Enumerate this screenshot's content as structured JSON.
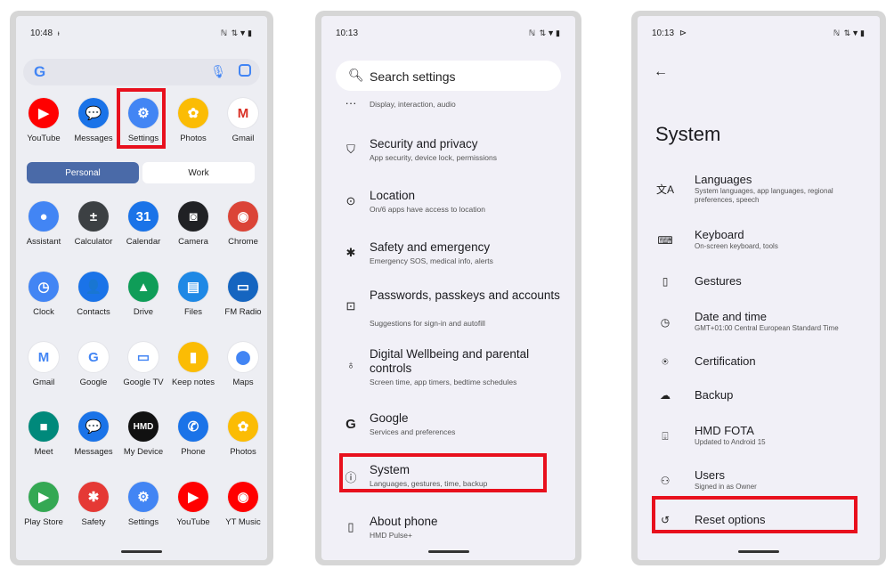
{
  "phone1": {
    "status_time": "10:48",
    "status_time_suffix": "ᵻ",
    "status_icons": "ℕ ⇅▼▮",
    "search_logo": "G",
    "top_apps": [
      {
        "label": "YouTube",
        "color": "#ff0000",
        "glyph": "▶"
      },
      {
        "label": "Messages",
        "color": "#1a73e8",
        "glyph": "💬"
      },
      {
        "label": "Settings",
        "color": "#4285f4",
        "glyph": "⚙"
      },
      {
        "label": "Photos",
        "color": "#fbbc04",
        "glyph": "✿"
      },
      {
        "label": "Gmail",
        "color": "#ffffff",
        "glyph": "M"
      }
    ],
    "tabs": {
      "personal": "Personal",
      "work": "Work"
    },
    "grid_apps": [
      {
        "label": "Assistant",
        "color": "#4285f4",
        "glyph": "●"
      },
      {
        "label": "Calculator",
        "color": "#3c4043",
        "glyph": "±"
      },
      {
        "label": "Calendar",
        "color": "#1a73e8",
        "glyph": "31"
      },
      {
        "label": "Camera",
        "color": "#202124",
        "glyph": "◙"
      },
      {
        "label": "Chrome",
        "color": "#db4437",
        "glyph": "◉"
      },
      {
        "label": "Clock",
        "color": "#4285f4",
        "glyph": "◷"
      },
      {
        "label": "Contacts",
        "color": "#1a73e8",
        "glyph": "👤"
      },
      {
        "label": "Drive",
        "color": "#0f9d58",
        "glyph": "▲"
      },
      {
        "label": "Files",
        "color": "#1e88e5",
        "glyph": "▤"
      },
      {
        "label": "FM Radio",
        "color": "#1565c0",
        "glyph": "▭"
      },
      {
        "label": "Gmail",
        "color": "#ffffff",
        "glyph": "M"
      },
      {
        "label": "Google",
        "color": "#ffffff",
        "glyph": "G"
      },
      {
        "label": "Google TV",
        "color": "#ffffff",
        "glyph": "▭"
      },
      {
        "label": "Keep notes",
        "color": "#fbbc04",
        "glyph": "▮"
      },
      {
        "label": "Maps",
        "color": "#ffffff",
        "glyph": "⬤"
      },
      {
        "label": "Meet",
        "color": "#00897b",
        "glyph": "■"
      },
      {
        "label": "Messages",
        "color": "#1a73e8",
        "glyph": "💬"
      },
      {
        "label": "My Device",
        "color": "#111111",
        "glyph": "HMD"
      },
      {
        "label": "Phone",
        "color": "#1a73e8",
        "glyph": "✆"
      },
      {
        "label": "Photos",
        "color": "#fbbc04",
        "glyph": "✿"
      },
      {
        "label": "Play Store",
        "color": "#34a853",
        "glyph": "▶"
      },
      {
        "label": "Safety",
        "color": "#e53935",
        "glyph": "✱"
      },
      {
        "label": "Settings",
        "color": "#4285f4",
        "glyph": "⚙"
      },
      {
        "label": "YouTube",
        "color": "#ff0000",
        "glyph": "▶"
      },
      {
        "label": "YT Music",
        "color": "#ff0000",
        "glyph": "◉"
      }
    ]
  },
  "phone2": {
    "status_time": "10:13",
    "status_icons": "ℕ ⇅▼▮",
    "search_placeholder": "Search settings",
    "partial_subtitle": "Display, interaction, audio",
    "rows": [
      {
        "icon": "shield-icon",
        "glyph": "⛉",
        "title": "Security and privacy",
        "subtitle": "App security, device lock, permissions"
      },
      {
        "icon": "location-icon",
        "glyph": "⊙",
        "title": "Location",
        "subtitle": "On/6 apps have access to location"
      },
      {
        "icon": "asterisk-icon",
        "glyph": "✱",
        "title": "Safety and emergency",
        "subtitle": "Emergency SOS, medical info, alerts"
      },
      {
        "icon": "passkey-icon",
        "glyph": "⊡",
        "title": "Passwords, passkeys and accounts",
        "subtitle": "Suggestions for sign-in and autofill"
      },
      {
        "icon": "wellbeing-icon",
        "glyph": "♁",
        "title": "Digital Wellbeing and parental controls",
        "subtitle": "Screen time, app timers, bedtime schedules"
      },
      {
        "icon": "google-icon",
        "glyph": "G",
        "title": "Google",
        "subtitle": "Services and preferences"
      },
      {
        "icon": "info-icon",
        "glyph": "ⓘ",
        "title": "System",
        "subtitle": "Languages, gestures, time, backup"
      },
      {
        "icon": "phone-icon",
        "glyph": "▯",
        "title": "About phone",
        "subtitle": "HMD Pulse+"
      }
    ]
  },
  "phone3": {
    "status_time": "10:13",
    "status_time_suffix": "⊳",
    "status_icons": "ℕ ⇅▼▮",
    "back": "←",
    "title": "System",
    "rows": [
      {
        "icon": "translate-icon",
        "glyph": "文A",
        "title": "Languages",
        "subtitle": "System languages, app languages, regional preferences, speech"
      },
      {
        "icon": "keyboard-icon",
        "glyph": "⌨",
        "title": "Keyboard",
        "subtitle": "On-screen keyboard, tools"
      },
      {
        "icon": "gestures-icon",
        "glyph": "▯",
        "title": "Gestures",
        "subtitle": ""
      },
      {
        "icon": "clock-icon",
        "glyph": "◷",
        "title": "Date and time",
        "subtitle": "GMT+01:00 Central European Standard Time"
      },
      {
        "icon": "certification-icon",
        "glyph": "⍟",
        "title": "Certification",
        "subtitle": ""
      },
      {
        "icon": "backup-icon",
        "glyph": "☁",
        "title": "Backup",
        "subtitle": ""
      },
      {
        "icon": "update-icon",
        "glyph": "⍗",
        "title": "HMD FOTA",
        "subtitle": "Updated to Android 15"
      },
      {
        "icon": "users-icon",
        "glyph": "⚇",
        "title": "Users",
        "subtitle": "Signed in as Owner"
      },
      {
        "icon": "reset-icon",
        "glyph": "↺",
        "title": "Reset options",
        "subtitle": ""
      }
    ]
  },
  "colors": {
    "highlight": "#e8101d",
    "accent": "#4a6aa8"
  }
}
